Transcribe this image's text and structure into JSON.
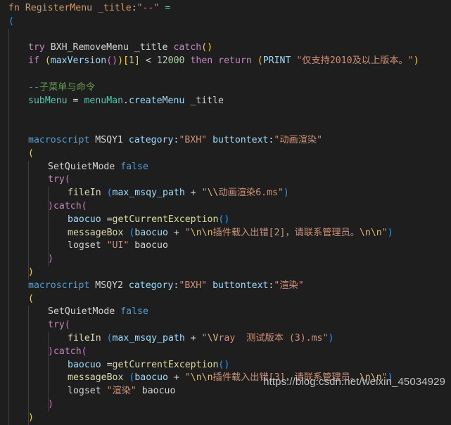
{
  "editor": {
    "background": "#1e1e1e",
    "language": "MAXScript",
    "watermark": "https://blog.csdn.net/weixin_45034929"
  },
  "palette": {
    "definition_orange": "#d19a66",
    "keyword_magenta": "#c586c0",
    "plain_text": "#d4d4d4",
    "variable_blue": "#9cdcfe",
    "function_khaki": "#dcdcaa",
    "string_orange": "#ce9178",
    "escape_gold": "#d7ba7d",
    "number_green": "#b5cea8",
    "comment_green": "#6a9955",
    "type_teal": "#4ec9b0",
    "keyword_blue": "#569cd6",
    "bracket_gold": "#ffd700",
    "bracket_pink": "#da70d6",
    "bracket_blue": "#179fff",
    "indent_guide": "#404040"
  },
  "code": {
    "lines": [
      {
        "n": 1,
        "indent": 0,
        "guides": 0,
        "text": "fn RegisterMenu _title:\"--\" ="
      },
      {
        "n": 2,
        "indent": 0,
        "guides": 0,
        "text": "("
      },
      {
        "n": 3,
        "indent": 0,
        "guides": 1,
        "text": ""
      },
      {
        "n": 4,
        "indent": 1,
        "guides": 1,
        "text": "try BXH_RemoveMenu _title catch()"
      },
      {
        "n": 5,
        "indent": 1,
        "guides": 1,
        "text": "if (maxVersion())[1] < 12000 then return (PRINT \"仅支持2010及以上版本。\")"
      },
      {
        "n": 6,
        "indent": 0,
        "guides": 1,
        "text": ""
      },
      {
        "n": 7,
        "indent": 1,
        "guides": 1,
        "text": "--子菜单与命令"
      },
      {
        "n": 8,
        "indent": 1,
        "guides": 1,
        "text": "subMenu = menuMan.createMenu _title"
      },
      {
        "n": 9,
        "indent": 0,
        "guides": 1,
        "text": ""
      },
      {
        "n": 10,
        "indent": 0,
        "guides": 1,
        "text": ""
      },
      {
        "n": 11,
        "indent": 1,
        "guides": 1,
        "text": "macroscript MSQY1 category:\"BXH\" buttontext:\"动画渲染\""
      },
      {
        "n": 12,
        "indent": 1,
        "guides": 1,
        "text": "("
      },
      {
        "n": 13,
        "indent": 2,
        "guides": 2,
        "text": "SetQuietMode false"
      },
      {
        "n": 14,
        "indent": 2,
        "guides": 2,
        "text": "try("
      },
      {
        "n": 15,
        "indent": 3,
        "guides": 3,
        "text": "fileIn (max_msqy_path + \"\\\\动画渲染6.ms\")"
      },
      {
        "n": 16,
        "indent": 2,
        "guides": 3,
        "text": ")catch("
      },
      {
        "n": 17,
        "indent": 3,
        "guides": 3,
        "text": "baocuo =getCurrentException()"
      },
      {
        "n": 18,
        "indent": 3,
        "guides": 3,
        "text": "messageBox (baocuo + \"\\n\\n插件载入出错[2]，请联系管理员。\\n\\n\")"
      },
      {
        "n": 19,
        "indent": 3,
        "guides": 3,
        "text": "logset \"UI\" baocuo"
      },
      {
        "n": 20,
        "indent": 2,
        "guides": 3,
        "text": ")"
      },
      {
        "n": 21,
        "indent": 1,
        "guides": 2,
        "text": ")"
      },
      {
        "n": 22,
        "indent": 1,
        "guides": 1,
        "text": "macroscript MSQY2 category:\"BXH\" buttontext:\"渲染\""
      },
      {
        "n": 23,
        "indent": 1,
        "guides": 1,
        "text": "("
      },
      {
        "n": 24,
        "indent": 2,
        "guides": 2,
        "text": "SetQuietMode false"
      },
      {
        "n": 25,
        "indent": 2,
        "guides": 2,
        "text": "try("
      },
      {
        "n": 26,
        "indent": 3,
        "guides": 3,
        "text": "fileIn (max_msqy_path + \"\\Vray  测试版本 (3).ms\")"
      },
      {
        "n": 27,
        "indent": 2,
        "guides": 3,
        "text": ")catch("
      },
      {
        "n": 28,
        "indent": 3,
        "guides": 3,
        "text": "baocuo =getCurrentException()"
      },
      {
        "n": 29,
        "indent": 3,
        "guides": 3,
        "text": "messageBox (baocuo + \"\\n\\n插件载入出错[3]，请联系管理员。\\n\\n\")"
      },
      {
        "n": 30,
        "indent": 3,
        "guides": 3,
        "text": "logset \"渲染\" baocuo"
      },
      {
        "n": 31,
        "indent": 2,
        "guides": 3,
        "text": ")"
      },
      {
        "n": 32,
        "indent": 1,
        "guides": 2,
        "text": ")"
      }
    ],
    "tokens": {
      "l1": [
        {
          "t": "fn",
          "c": "c-def"
        },
        {
          "t": " ",
          "c": "c-plain"
        },
        {
          "t": "RegisterMenu",
          "c": "c-def"
        },
        {
          "t": " ",
          "c": "c-plain"
        },
        {
          "t": "_title",
          "c": "c-def"
        },
        {
          "t": ":",
          "c": "c-plain"
        },
        {
          "t": "\"--\"",
          "c": "c-str"
        },
        {
          "t": " ",
          "c": "c-plain"
        },
        {
          "t": "=",
          "c": "c-type"
        }
      ],
      "l2": [
        {
          "t": "(",
          "c": "c-br3"
        }
      ],
      "l4": [
        {
          "t": "try",
          "c": "c-kw"
        },
        {
          "t": " BXH_RemoveMenu _title ",
          "c": "c-plain"
        },
        {
          "t": "catch",
          "c": "c-kw"
        },
        {
          "t": "(",
          "c": "c-br1"
        },
        {
          "t": ")",
          "c": "c-br1"
        }
      ],
      "l5": [
        {
          "t": "if",
          "c": "c-kw"
        },
        {
          "t": " ",
          "c": "c-plain"
        },
        {
          "t": "(",
          "c": "c-br1"
        },
        {
          "t": "maxVersion",
          "c": "c-fn"
        },
        {
          "t": "(",
          "c": "c-br2"
        },
        {
          "t": ")",
          "c": "c-br2"
        },
        {
          "t": ")",
          "c": "c-br1"
        },
        {
          "t": "[",
          "c": "c-br1"
        },
        {
          "t": "1",
          "c": "c-num"
        },
        {
          "t": "]",
          "c": "c-br1"
        },
        {
          "t": " ",
          "c": "c-plain"
        },
        {
          "t": "<",
          "c": "c-plain"
        },
        {
          "t": " ",
          "c": "c-plain"
        },
        {
          "t": "12000",
          "c": "c-num"
        },
        {
          "t": " ",
          "c": "c-plain"
        },
        {
          "t": "then",
          "c": "c-kw"
        },
        {
          "t": " ",
          "c": "c-plain"
        },
        {
          "t": "return",
          "c": "c-kw"
        },
        {
          "t": " ",
          "c": "c-plain"
        },
        {
          "t": "(",
          "c": "c-br1"
        },
        {
          "t": "PRINT",
          "c": "c-fn"
        },
        {
          "t": " ",
          "c": "c-plain"
        },
        {
          "t": "\"仅支持2010及以上版本。\"",
          "c": "c-str"
        },
        {
          "t": ")",
          "c": "c-br1"
        }
      ],
      "l7": [
        {
          "t": "--子菜单与命令",
          "c": "c-cmt"
        }
      ],
      "l8": [
        {
          "t": "subMenu",
          "c": "c-type"
        },
        {
          "t": " ",
          "c": "c-plain"
        },
        {
          "t": "=",
          "c": "c-plain"
        },
        {
          "t": " ",
          "c": "c-plain"
        },
        {
          "t": "menuMan",
          "c": "c-type"
        },
        {
          "t": ".",
          "c": "c-plain"
        },
        {
          "t": "createMenu",
          "c": "c-fn"
        },
        {
          "t": " _title",
          "c": "c-plain"
        }
      ],
      "l11": [
        {
          "t": "macroscript",
          "c": "c-blue"
        },
        {
          "t": " MSQY1 ",
          "c": "c-plain"
        },
        {
          "t": "category",
          "c": "c-fn"
        },
        {
          "t": ":",
          "c": "c-plain"
        },
        {
          "t": "\"BXH\"",
          "c": "c-str"
        },
        {
          "t": " ",
          "c": "c-plain"
        },
        {
          "t": "buttontext",
          "c": "c-fn"
        },
        {
          "t": ":",
          "c": "c-plain"
        },
        {
          "t": "\"动画渲染\"",
          "c": "c-str"
        }
      ],
      "l12": [
        {
          "t": "(",
          "c": "c-br1"
        }
      ],
      "l13": [
        {
          "t": "SetQuietMode",
          "c": "c-plain"
        },
        {
          "t": " ",
          "c": "c-plain"
        },
        {
          "t": "false",
          "c": "c-blue"
        }
      ],
      "l14": [
        {
          "t": "try",
          "c": "c-kw"
        },
        {
          "t": "(",
          "c": "c-br2"
        }
      ],
      "l15": [
        {
          "t": "fileIn",
          "c": "c-call"
        },
        {
          "t": " ",
          "c": "c-plain"
        },
        {
          "t": "(",
          "c": "c-br3"
        },
        {
          "t": "max_msqy_path",
          "c": "c-fn"
        },
        {
          "t": " ",
          "c": "c-plain"
        },
        {
          "t": "+",
          "c": "c-plain"
        },
        {
          "t": " ",
          "c": "c-plain"
        },
        {
          "t": "\"",
          "c": "c-str"
        },
        {
          "t": "\\\\",
          "c": "c-esc"
        },
        {
          "t": "动画渲染6.ms\"",
          "c": "c-str"
        },
        {
          "t": ")",
          "c": "c-br3"
        }
      ],
      "l16": [
        {
          "t": ")",
          "c": "c-br2"
        },
        {
          "t": "catch",
          "c": "c-kw"
        },
        {
          "t": "(",
          "c": "c-br2"
        }
      ],
      "l17": [
        {
          "t": "baocuo",
          "c": "c-fn"
        },
        {
          "t": " =",
          "c": "c-plain"
        },
        {
          "t": "getCurrentException",
          "c": "c-call"
        },
        {
          "t": "(",
          "c": "c-br3"
        },
        {
          "t": ")",
          "c": "c-br3"
        }
      ],
      "l18": [
        {
          "t": "messageBox",
          "c": "c-call"
        },
        {
          "t": " ",
          "c": "c-plain"
        },
        {
          "t": "(",
          "c": "c-br3"
        },
        {
          "t": "baocuo",
          "c": "c-fn"
        },
        {
          "t": " ",
          "c": "c-plain"
        },
        {
          "t": "+",
          "c": "c-plain"
        },
        {
          "t": " ",
          "c": "c-plain"
        },
        {
          "t": "\"",
          "c": "c-str"
        },
        {
          "t": "\\n\\n",
          "c": "c-esc"
        },
        {
          "t": "插件载入出错[2]，请联系管理员。",
          "c": "c-str"
        },
        {
          "t": "\\n\\n",
          "c": "c-esc"
        },
        {
          "t": "\"",
          "c": "c-str"
        },
        {
          "t": ")",
          "c": "c-br3"
        }
      ],
      "l19": [
        {
          "t": "logset",
          "c": "c-plain"
        },
        {
          "t": " ",
          "c": "c-plain"
        },
        {
          "t": "\"UI\"",
          "c": "c-str"
        },
        {
          "t": " baocuo",
          "c": "c-plain"
        }
      ],
      "l20": [
        {
          "t": ")",
          "c": "c-br2"
        }
      ],
      "l21": [
        {
          "t": ")",
          "c": "c-br1"
        }
      ],
      "l22": [
        {
          "t": "macroscript",
          "c": "c-blue"
        },
        {
          "t": " MSQY2 ",
          "c": "c-plain"
        },
        {
          "t": "category",
          "c": "c-fn"
        },
        {
          "t": ":",
          "c": "c-plain"
        },
        {
          "t": "\"BXH\"",
          "c": "c-str"
        },
        {
          "t": " ",
          "c": "c-plain"
        },
        {
          "t": "buttontext",
          "c": "c-fn"
        },
        {
          "t": ":",
          "c": "c-plain"
        },
        {
          "t": "\"渲染\"",
          "c": "c-str"
        }
      ],
      "l23": [
        {
          "t": "(",
          "c": "c-br1"
        }
      ],
      "l24": [
        {
          "t": "SetQuietMode",
          "c": "c-plain"
        },
        {
          "t": " ",
          "c": "c-plain"
        },
        {
          "t": "false",
          "c": "c-blue"
        }
      ],
      "l25": [
        {
          "t": "try",
          "c": "c-kw"
        },
        {
          "t": "(",
          "c": "c-br2"
        }
      ],
      "l26": [
        {
          "t": "fileIn",
          "c": "c-call"
        },
        {
          "t": " ",
          "c": "c-plain"
        },
        {
          "t": "(",
          "c": "c-br3"
        },
        {
          "t": "max_msqy_path",
          "c": "c-fn"
        },
        {
          "t": " ",
          "c": "c-plain"
        },
        {
          "t": "+",
          "c": "c-plain"
        },
        {
          "t": " ",
          "c": "c-plain"
        },
        {
          "t": "\"",
          "c": "c-str"
        },
        {
          "t": "\\V",
          "c": "c-esc"
        },
        {
          "t": "ray  测试版本 (3).ms\"",
          "c": "c-str"
        },
        {
          "t": ")",
          "c": "c-br3"
        }
      ],
      "l27": [
        {
          "t": ")",
          "c": "c-br2"
        },
        {
          "t": "catch",
          "c": "c-kw"
        },
        {
          "t": "(",
          "c": "c-br2"
        }
      ],
      "l28": [
        {
          "t": "baocuo",
          "c": "c-fn"
        },
        {
          "t": " =",
          "c": "c-plain"
        },
        {
          "t": "getCurrentException",
          "c": "c-call"
        },
        {
          "t": "(",
          "c": "c-br3"
        },
        {
          "t": ")",
          "c": "c-br3"
        }
      ],
      "l29": [
        {
          "t": "messageBox",
          "c": "c-call"
        },
        {
          "t": " ",
          "c": "c-plain"
        },
        {
          "t": "(",
          "c": "c-br3"
        },
        {
          "t": "baocuo",
          "c": "c-fn"
        },
        {
          "t": " ",
          "c": "c-plain"
        },
        {
          "t": "+",
          "c": "c-plain"
        },
        {
          "t": " ",
          "c": "c-plain"
        },
        {
          "t": "\"",
          "c": "c-str"
        },
        {
          "t": "\\n\\n",
          "c": "c-esc"
        },
        {
          "t": "插件载入出错[3]，请联系管理员。",
          "c": "c-str"
        },
        {
          "t": "\\n\\n",
          "c": "c-esc"
        },
        {
          "t": "\"",
          "c": "c-str"
        },
        {
          "t": ")",
          "c": "c-br3"
        }
      ],
      "l30": [
        {
          "t": "logset",
          "c": "c-plain"
        },
        {
          "t": " ",
          "c": "c-plain"
        },
        {
          "t": "\"渲染\"",
          "c": "c-str"
        },
        {
          "t": " baocuo",
          "c": "c-plain"
        }
      ],
      "l31": [
        {
          "t": ")",
          "c": "c-br2"
        }
      ],
      "l32": [
        {
          "t": ")",
          "c": "c-br1"
        }
      ]
    }
  }
}
